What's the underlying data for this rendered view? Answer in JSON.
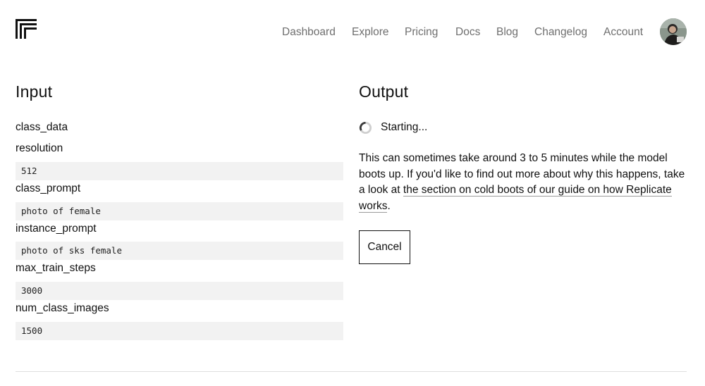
{
  "logo_icon": "replicate-logo-icon",
  "nav": {
    "items": [
      {
        "label": "Dashboard"
      },
      {
        "label": "Explore"
      },
      {
        "label": "Pricing"
      },
      {
        "label": "Docs"
      },
      {
        "label": "Blog"
      },
      {
        "label": "Changelog"
      },
      {
        "label": "Account"
      }
    ],
    "avatar_icon": "user-avatar"
  },
  "input": {
    "title": "Input",
    "fields": [
      {
        "name": "class_data"
      },
      {
        "name": "resolution",
        "value": "512"
      },
      {
        "name": "class_prompt",
        "value": "photo of female"
      },
      {
        "name": "instance_prompt",
        "value": "photo of sks female"
      },
      {
        "name": "max_train_steps",
        "value": "3000"
      },
      {
        "name": "num_class_images",
        "value": "1500"
      }
    ]
  },
  "output": {
    "title": "Output",
    "status": "Starting...",
    "spinner_icon": "loading-spinner-icon",
    "message_text": "This can sometimes take around 3 to 5 minutes while the model boots up. If you'd like to find out more about why this happens, take a look at ",
    "message_link": "the section on cold boots of our guide on how Replicate works",
    "message_end": ".",
    "cancel_label": "Cancel"
  },
  "colors": {
    "nav_text": "#6f6f6f",
    "field_background": "#f2f2f2",
    "text": "#111111",
    "divider": "#dedede"
  }
}
